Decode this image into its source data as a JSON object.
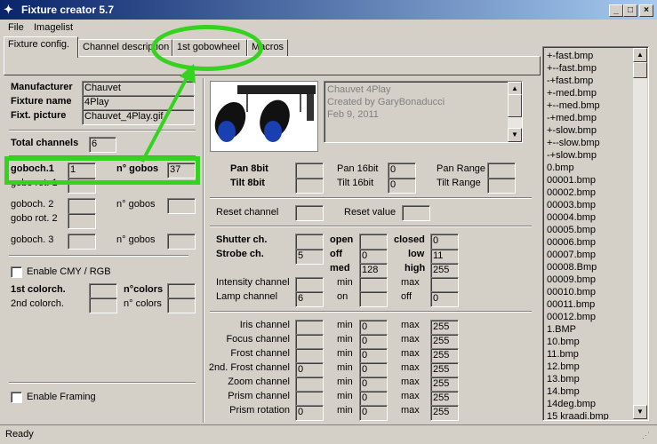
{
  "window": {
    "title": "Fixture creator 5.7"
  },
  "menu": {
    "file": "File",
    "imagelist": "Imagelist"
  },
  "tabs": [
    "Fixture config.",
    "Channel description",
    "1st gobowheel",
    "Macros"
  ],
  "fixture": {
    "manufacturer_label": "Manufacturer",
    "manufacturer": "Chauvet",
    "name_label": "Fixture name",
    "name": "4Play",
    "picture_label": "Fixt. picture",
    "picture": "Chauvet_4Play.gif",
    "total_label": "Total channels",
    "total": "6",
    "notes": [
      "Chauvet 4Play",
      "Created by GaryBonaducci",
      "Feb 9, 2011"
    ]
  },
  "gobo": {
    "goboch1": "goboch.1",
    "goboch1_val": "1",
    "ngobos_bold": "n° gobos",
    "ngobos1_val": "37",
    "gobo_rot1": "gobo rot. 1",
    "goboch2": "goboch. 2",
    "ngobos2": "n° gobos",
    "gobo_rot2": "gobo rot. 2",
    "goboch3": "goboch. 3",
    "ngobos3": "n° gobos"
  },
  "cmy": {
    "enable": "Enable CMY / RGB",
    "colorch1": "1st colorch.",
    "ncolors_bold": "n°colors",
    "colorch2": "2nd colorch.",
    "ncolors2": "n° colors"
  },
  "framing": {
    "enable": "Enable Framing"
  },
  "pantilt": {
    "pan8": "Pan 8bit",
    "tilt8": "Tilt 8bit",
    "pan16": "Pan 16bit",
    "pan16_val": "0",
    "tilt16": "Tilt 16bit",
    "tilt16_val": "0",
    "panrange": "Pan Range",
    "tiltrange": "Tilt Range"
  },
  "reset": {
    "channel": "Reset channel",
    "value": "Reset value"
  },
  "shutter": {
    "shutter_ch": "Shutter ch.",
    "strobe_ch": "Strobe ch.",
    "strobe_val": "5",
    "open": "open",
    "closed": "closed",
    "closed_val": "0",
    "off": "off",
    "off_val": "0",
    "low": "low",
    "low_val": "11",
    "med": "med",
    "med_val": "128",
    "high": "high",
    "high_val": "255"
  },
  "intensity": {
    "intensity_ch": "Intensity channel",
    "min": "min",
    "max": "max",
    "lamp_ch": "Lamp channel",
    "lamp_val": "6",
    "on": "on",
    "off": "off",
    "off_val": "0"
  },
  "channels": [
    {
      "label": "Iris channel",
      "ch": "",
      "min": "0",
      "max": "255"
    },
    {
      "label": "Focus channel",
      "ch": "",
      "min": "0",
      "max": "255"
    },
    {
      "label": "Frost channel",
      "ch": "",
      "min": "0",
      "max": "255"
    },
    {
      "label": "2nd. Frost channel",
      "ch": "0",
      "min": "0",
      "max": "255"
    },
    {
      "label": "Zoom channel",
      "ch": "",
      "min": "0",
      "max": "255"
    },
    {
      "label": "Prism channel",
      "ch": "",
      "min": "0",
      "max": "255"
    },
    {
      "label": "Prism rotation",
      "ch": "0",
      "min": "0",
      "max": "255"
    }
  ],
  "min_label": "min",
  "max_label": "max",
  "images": [
    "+-fast.bmp",
    "+--fast.bmp",
    "-+fast.bmp",
    "+-med.bmp",
    "+--med.bmp",
    "-+med.bmp",
    "+-slow.bmp",
    "+--slow.bmp",
    "-+slow.bmp",
    "0.bmp",
    "00001.bmp",
    "00002.bmp",
    "00003.bmp",
    "00004.bmp",
    "00005.bmp",
    "00006.bmp",
    "00007.bmp",
    "00008.Bmp",
    "00009.bmp",
    "00010.bmp",
    "00011.bmp",
    "00012.bmp",
    "1.BMP",
    "10.bmp",
    "11.bmp",
    "12.bmp",
    "13.bmp",
    "14.bmp",
    "14deg.bmp",
    "15 kraadi.bmp"
  ],
  "status": "Ready",
  "colors": {
    "highlight": "#35d21f",
    "titlebar": "#0a246a"
  },
  "icons": [
    "app-icon",
    "minimize-icon",
    "maximize-icon",
    "close-icon",
    "scroll-up-icon",
    "scroll-down-icon"
  ]
}
